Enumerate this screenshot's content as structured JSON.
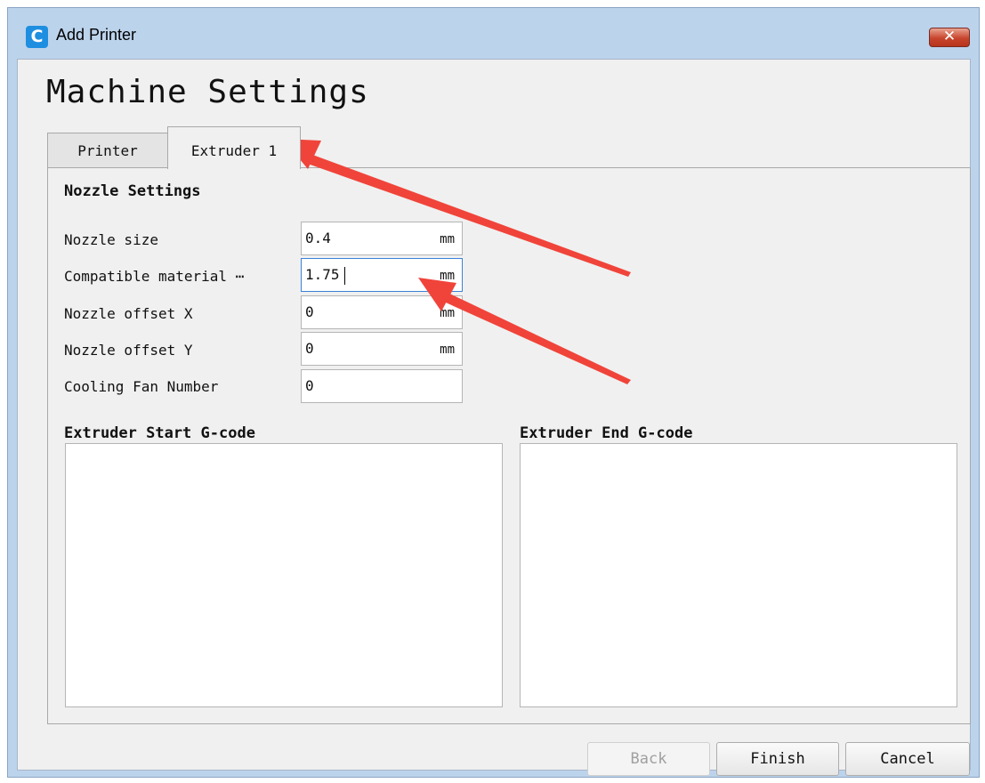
{
  "window": {
    "title": "Add Printer",
    "app_icon_glyph": "C",
    "close_glyph": "✕"
  },
  "page_title": "Machine Settings",
  "tabs": [
    {
      "label": "Printer",
      "active": false
    },
    {
      "label": "Extruder 1",
      "active": true
    }
  ],
  "nozzle_settings": {
    "title": "Nozzle Settings",
    "fields": [
      {
        "label": "Nozzle size",
        "value": "0.4",
        "unit": "mm"
      },
      {
        "label": "Compatible material ⋯",
        "value": "1.75",
        "unit": "mm"
      },
      {
        "label": "Nozzle offset X",
        "value": "0",
        "unit": "mm"
      },
      {
        "label": "Nozzle offset Y",
        "value": "0",
        "unit": "mm"
      },
      {
        "label": "Cooling Fan Number",
        "value": "0",
        "unit": ""
      }
    ]
  },
  "gcode": {
    "start_label": "Extruder Start G-code",
    "start_value": "",
    "end_label": "Extruder End G-code",
    "end_value": ""
  },
  "buttons": {
    "back": "Back",
    "finish": "Finish",
    "cancel": "Cancel"
  },
  "colors": {
    "annotation_arrow": "#f0443a",
    "titlebar": "#bcd3ec",
    "focus_border": "#3c82d6"
  },
  "icons": {
    "app": "creality-app-icon",
    "close": "close-icon"
  }
}
